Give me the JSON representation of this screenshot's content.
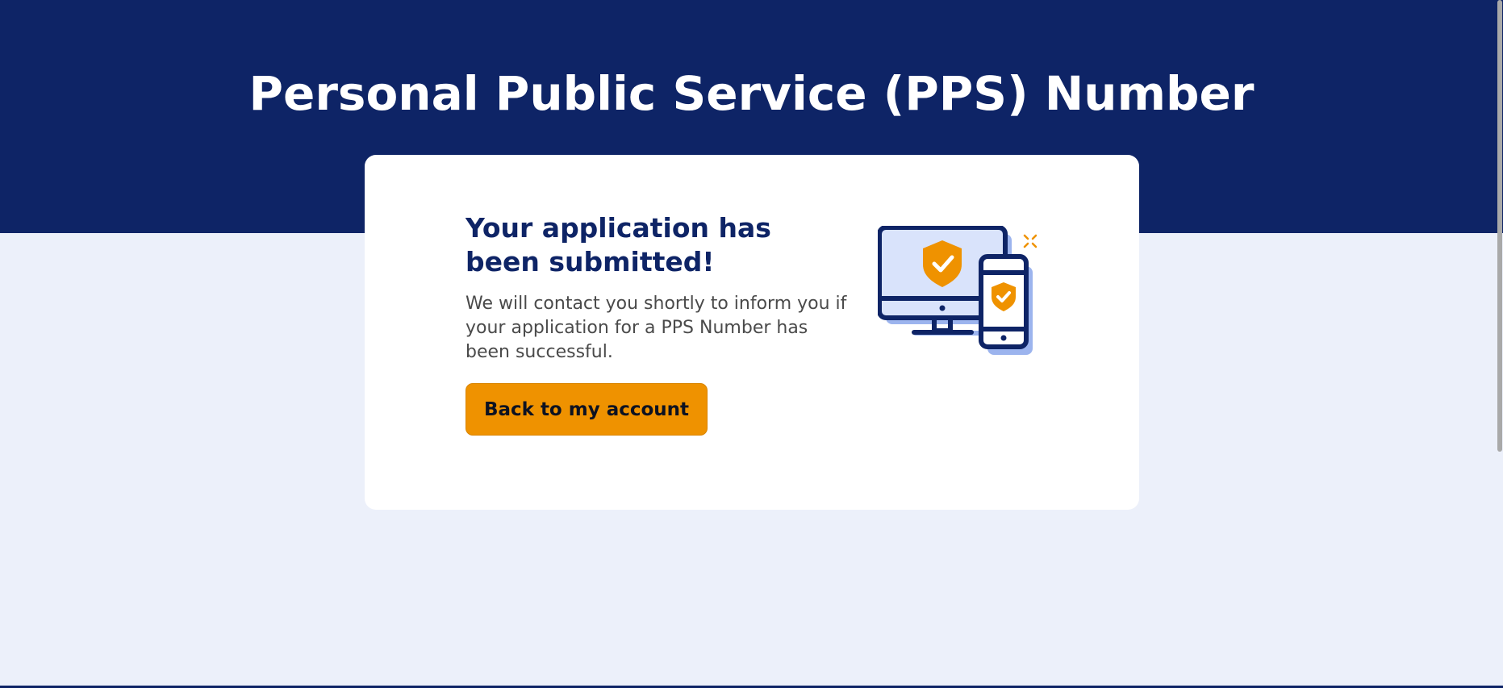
{
  "page": {
    "title": "Personal Public Service (PPS) Number"
  },
  "confirmation": {
    "heading": "Your application has been submitted!",
    "message": "We will contact you shortly to inform you if your application for a PPS Number has been successful.",
    "back_button_label": "Back to my account",
    "illustration_icon": "devices-security-check-icon"
  },
  "colors": {
    "header_bg": "#0e2466",
    "page_bg": "#ecf0fa",
    "accent": "#ef9200",
    "card_bg": "#ffffff"
  }
}
